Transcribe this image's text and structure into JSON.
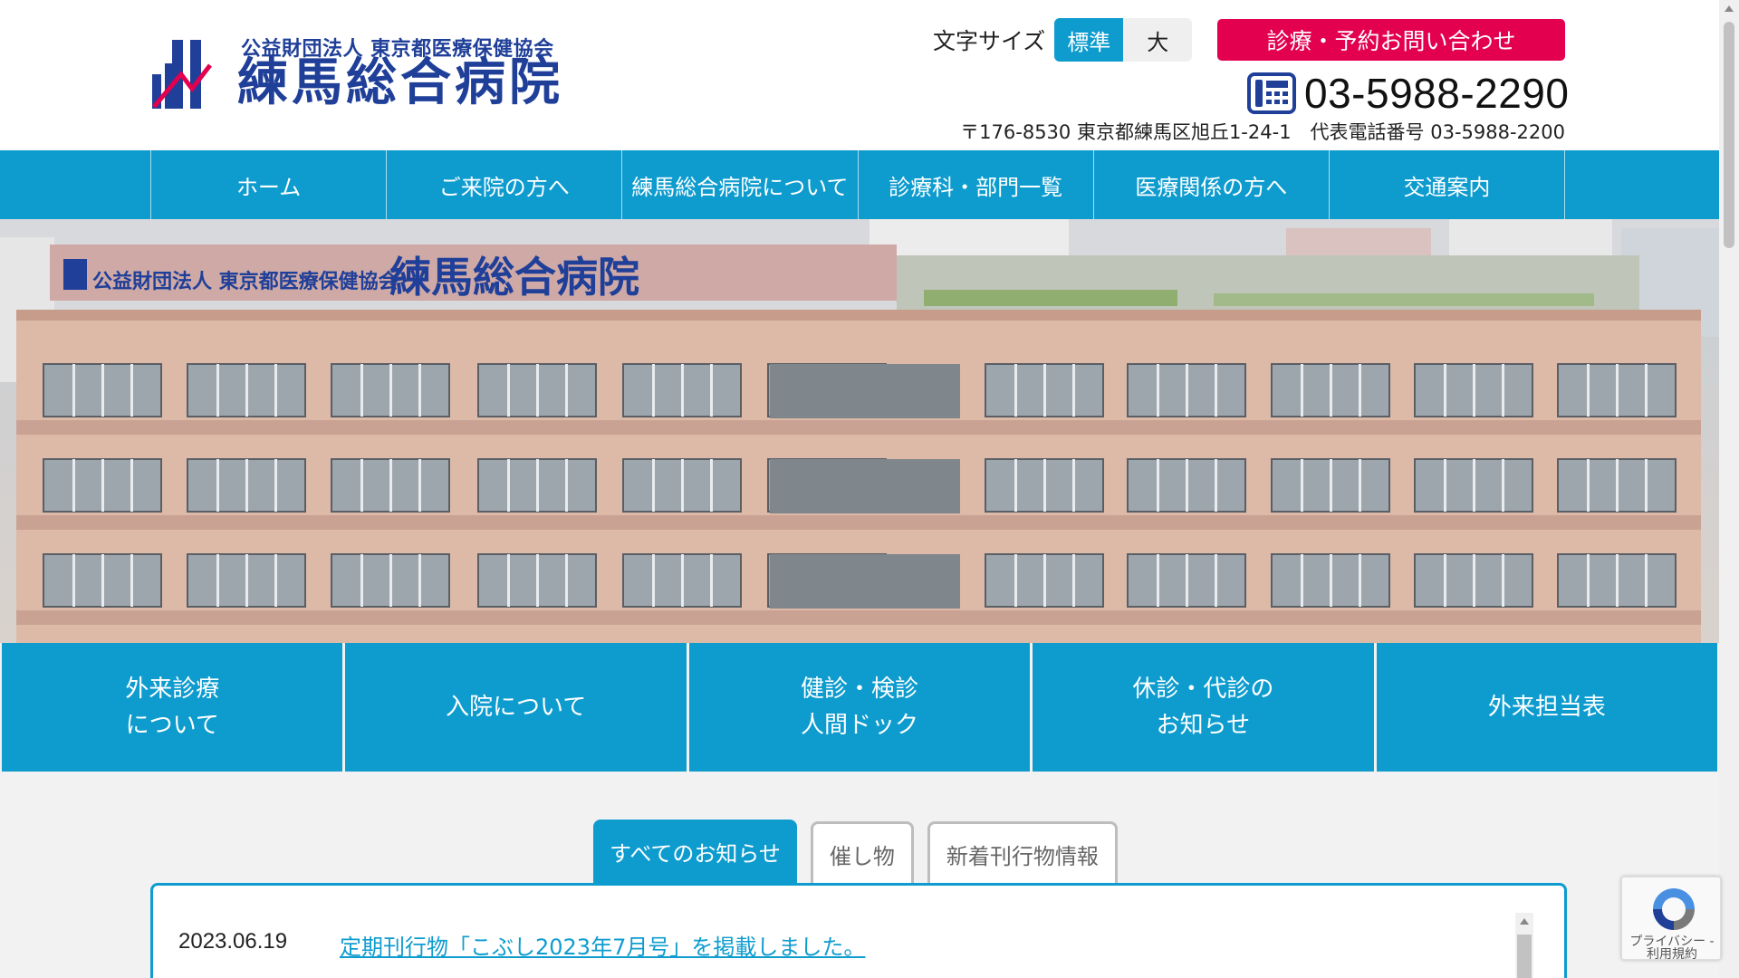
{
  "header": {
    "logo": {
      "sub_text": "公益財団法人 東京都医療保健協会",
      "main_text": "練馬総合病院"
    },
    "font_size": {
      "label": "文字サイズ",
      "standard": "標準",
      "large": "大",
      "selected": "標準"
    },
    "contact_button": "診療・予約お問い合わせ",
    "phone": "03-5988-2290",
    "address": "〒176-8530 東京都練馬区旭丘1-24-1　代表電話番号 03-5988-2200"
  },
  "nav": {
    "items": [
      {
        "label": "ホーム"
      },
      {
        "label": "ご来院の方へ"
      },
      {
        "label": "練馬総合病院について"
      },
      {
        "label": "診療科・部門一覧"
      },
      {
        "label": "医療関係の方へ"
      },
      {
        "label": "交通案内"
      }
    ]
  },
  "hero": {
    "sign_sub": "公益財団法人 東京都医療保健協会",
    "sign_main": "練馬総合病院"
  },
  "quick_links": [
    {
      "line1": "外来診療",
      "line2": "について"
    },
    {
      "line1": "入院について",
      "line2": ""
    },
    {
      "line1": "健診・検診",
      "line2": "人間ドック"
    },
    {
      "line1": "休診・代診の",
      "line2": "お知らせ"
    },
    {
      "line1": "外来担当表",
      "line2": ""
    }
  ],
  "news": {
    "tabs": [
      {
        "label": "すべてのお知らせ",
        "active": true
      },
      {
        "label": "催し物",
        "active": false
      },
      {
        "label": "新着刊行物情報",
        "active": false
      }
    ],
    "items": [
      {
        "date": "2023.06.19",
        "title": "定期刊行物「こぶし2023年7月号」を掲載しました。"
      }
    ]
  },
  "recaptcha": {
    "text": "プライバシー - 利用規約"
  },
  "colors": {
    "brand_blue": "#0e9ccf",
    "accent_red": "#e2004f",
    "logo_navy": "#1f3f99"
  }
}
